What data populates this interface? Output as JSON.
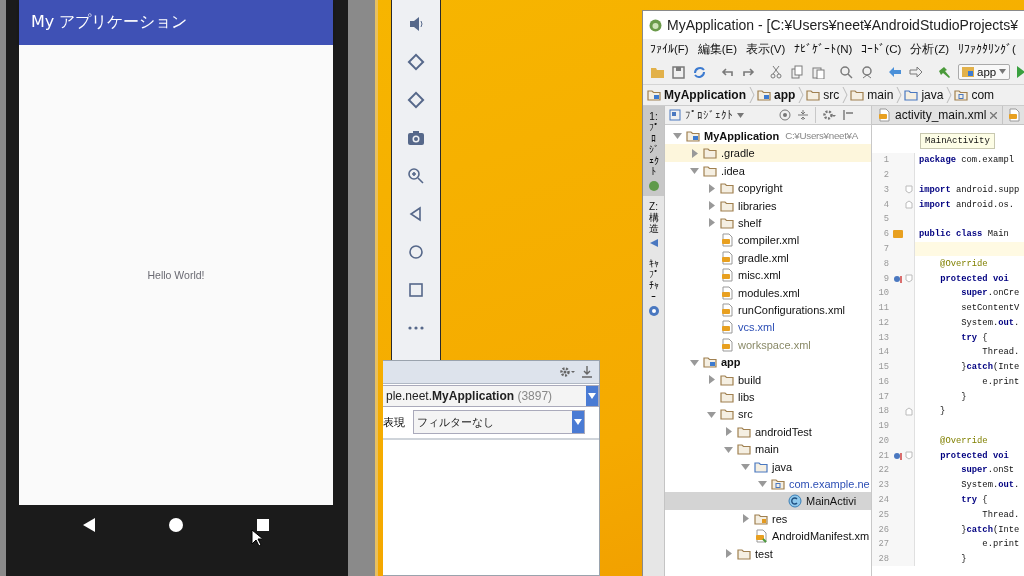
{
  "emulator": {
    "app_title": "My アプリケーション",
    "content_text": "Hello World!"
  },
  "logcat": {
    "process": "ple.neet.**MyApplication**",
    "process_id": "(3897)",
    "filter_label": "表現",
    "filter_value": "フィルターなし"
  },
  "studio": {
    "title": "MyApplication - [C:¥Users¥neet¥AndroidStudioProjects¥",
    "menu": [
      "ﾌｧｲﾙ(F)",
      "編集(E)",
      "表示(V)",
      "ﾅﾋﾞｹﾞｰﾄ(N)",
      "ｺｰﾄﾞ(C)",
      "分析(Z)",
      "ﾘﾌｧｸﾀﾘﾝｸﾞ("
    ],
    "run_config": "app",
    "breadcrumbs": [
      {
        "label": "MyApplication",
        "kind": "module"
      },
      {
        "label": "app",
        "kind": "module"
      },
      {
        "label": "src",
        "kind": "folder"
      },
      {
        "label": "main",
        "kind": "folder"
      },
      {
        "label": "java",
        "kind": "source"
      },
      {
        "label": "com",
        "kind": "package"
      }
    ],
    "tool_windows": [
      {
        "label": "1: ﾌﾟﾛｼﾞｪｸﾄ",
        "selected": true
      },
      {
        "label": "Z: 構造",
        "selected": false
      },
      {
        "label": "ｷｬﾌﾟﾁｬｰ",
        "selected": false
      }
    ],
    "project_view": {
      "title": "ﾌﾟﾛｼﾞｪｸﾄ",
      "tree": [
        {
          "label": "MyApplication",
          "note": "C:¥Users¥neet¥A",
          "kind": "module",
          "expanded": true,
          "selected": false,
          "highlighted": false,
          "children": [
            {
              "label": ".gradle",
              "kind": "folder",
              "expanded": false,
              "selected": false,
              "highlighted": true
            },
            {
              "label": ".idea",
              "kind": "folder",
              "expanded": true,
              "selected": false,
              "highlighted": false,
              "children": [
                {
                  "label": "copyright",
                  "kind": "folder",
                  "expanded": false,
                  "selected": false,
                  "highlighted": false
                },
                {
                  "label": "libraries",
                  "kind": "folder",
                  "expanded": false,
                  "selected": false,
                  "highlighted": false
                },
                {
                  "label": "shelf",
                  "kind": "folder",
                  "expanded": false,
                  "selected": false,
                  "highlighted": false
                },
                {
                  "label": "compiler.xml",
                  "kind": "xml",
                  "selected": false,
                  "highlighted": false
                },
                {
                  "label": "gradle.xml",
                  "kind": "xml",
                  "selected": false,
                  "highlighted": false
                },
                {
                  "label": "misc.xml",
                  "kind": "xml",
                  "selected": false,
                  "highlighted": false
                },
                {
                  "label": "modules.xml",
                  "kind": "xml",
                  "selected": false,
                  "highlighted": false
                },
                {
                  "label": "runConfigurations.xml",
                  "kind": "xml",
                  "selected": false,
                  "highlighted": false
                },
                {
                  "label": "vcs.xml",
                  "kind": "xml",
                  "selected": false,
                  "highlighted": false,
                  "color": "#2d4fb5"
                },
                {
                  "label": "workspace.xml",
                  "kind": "xml",
                  "selected": false,
                  "highlighted": false,
                  "color": "#8a8a68"
                }
              ]
            },
            {
              "label": "app",
              "kind": "module",
              "expanded": true,
              "selected": false,
              "highlighted": false,
              "children": [
                {
                  "label": "build",
                  "kind": "folder",
                  "expanded": false,
                  "selected": false,
                  "highlighted": false
                },
                {
                  "label": "libs",
                  "kind": "folder",
                  "selected": false,
                  "highlighted": false
                },
                {
                  "label": "src",
                  "kind": "folder",
                  "expanded": true,
                  "selected": false,
                  "highlighted": false,
                  "children": [
                    {
                      "label": "androidTest",
                      "kind": "folder",
                      "expanded": false,
                      "selected": false,
                      "highlighted": false
                    },
                    {
                      "label": "main",
                      "kind": "folder",
                      "expanded": true,
                      "selected": false,
                      "highlighted": false,
                      "children": [
                        {
                          "label": "java",
                          "kind": "source",
                          "expanded": true,
                          "selected": false,
                          "highlighted": false,
                          "children": [
                            {
                              "label": "com.example.ne",
                              "kind": "package",
                              "expanded": true,
                              "selected": false,
                              "highlighted": false,
                              "color": "#2d4fb5",
                              "children": [
                                {
                                  "label": "MainActivi",
                                  "kind": "class",
                                  "selected": true,
                                  "highlighted": false
                                }
                              ]
                            }
                          ]
                        },
                        {
                          "label": "res",
                          "kind": "resources",
                          "expanded": false,
                          "selected": false,
                          "highlighted": false
                        },
                        {
                          "label": "AndroidManifest.xm",
                          "kind": "manifest",
                          "selected": false,
                          "highlighted": false
                        }
                      ]
                    },
                    {
                      "label": "test",
                      "kind": "folder",
                      "expanded": false,
                      "selected": false,
                      "highlighted": false
                    }
                  ]
                }
              ]
            }
          ]
        }
      ]
    },
    "editor": {
      "tabs": [
        {
          "label": "activity_main.xml"
        }
      ],
      "tooltip": "MainActivity",
      "lines": [
        {
          "n": "1",
          "text": "**package** com.exampl",
          "current": false
        },
        {
          "n": "2",
          "current": false
        },
        {
          "n": "3",
          "text": "**import** android.supp",
          "current": false,
          "fold": {
            "kind": "start"
          }
        },
        {
          "n": "4",
          "text": "**import** android.os.",
          "current": false,
          "fold": {
            "kind": "end"
          }
        },
        {
          "n": "5",
          "current": false
        },
        {
          "n": "6",
          "text": "**public class** Main",
          "current": false,
          "marker": {
            "kind": "class"
          }
        },
        {
          "n": "7",
          "current": true
        },
        {
          "n": "8",
          "text": "    @Override",
          "current": false,
          "kind": "annotation"
        },
        {
          "n": "9",
          "text": "    **protected** **voi**",
          "current": false,
          "marker": {
            "kind": "override"
          },
          "fold": {
            "kind": "start"
          }
        },
        {
          "n": "10",
          "text": "        **super**.onCre",
          "current": false
        },
        {
          "n": "11",
          "text": "        setContentV",
          "current": false
        },
        {
          "n": "12",
          "text": "        System.**out**.",
          "current": false
        },
        {
          "n": "13",
          "text": "        **try** {",
          "current": false
        },
        {
          "n": "14",
          "text": "            Thread.",
          "current": false
        },
        {
          "n": "15",
          "text": "        }**catch**(Inte",
          "current": false
        },
        {
          "n": "16",
          "text": "            e.print",
          "current": false
        },
        {
          "n": "17",
          "text": "        }",
          "current": false
        },
        {
          "n": "18",
          "text": "    }",
          "current": false,
          "fold": {
            "kind": "end"
          }
        },
        {
          "n": "19",
          "current": false
        },
        {
          "n": "20",
          "text": "    @Override",
          "current": false,
          "kind": "annotation"
        },
        {
          "n": "21",
          "text": "    **protected** **voi**",
          "current": false,
          "marker": {
            "kind": "override"
          },
          "fold": {
            "kind": "start"
          }
        },
        {
          "n": "22",
          "text": "        **super**.onSt",
          "current": false
        },
        {
          "n": "23",
          "text": "        System.**out**.",
          "current": false
        },
        {
          "n": "24",
          "text": "        **try** {",
          "current": false
        },
        {
          "n": "25",
          "text": "            Thread.",
          "current": false
        },
        {
          "n": "26",
          "text": "        }**catch**(Inte",
          "current": false
        },
        {
          "n": "27",
          "text": "            e.print",
          "current": false
        },
        {
          "n": "28",
          "text": "        }",
          "current": false
        }
      ]
    }
  }
}
